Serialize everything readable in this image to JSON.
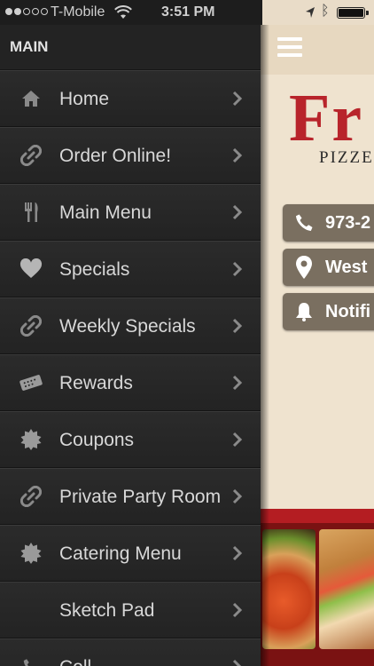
{
  "status_bar": {
    "carrier": "T-Mobile",
    "time": "3:51 PM",
    "signal_bars_filled": 2,
    "signal_bars_total": 5
  },
  "sidebar": {
    "header": "MAIN",
    "items": [
      {
        "label": "Home",
        "icon": "home-icon"
      },
      {
        "label": "Order Online!",
        "icon": "link-icon"
      },
      {
        "label": "Main Menu",
        "icon": "fork-knife-icon"
      },
      {
        "label": "Specials",
        "icon": "heart-icon"
      },
      {
        "label": "Weekly Specials",
        "icon": "link-icon"
      },
      {
        "label": "Rewards",
        "icon": "ticket-icon"
      },
      {
        "label": "Coupons",
        "icon": "badge-icon"
      },
      {
        "label": "Private Party Room",
        "icon": "link-icon"
      },
      {
        "label": "Catering Menu",
        "icon": "badge-icon"
      },
      {
        "label": "Sketch Pad",
        "icon": ""
      },
      {
        "label": "Coll",
        "icon": "phone-icon"
      }
    ]
  },
  "main": {
    "brand_title": "Fr",
    "brand_subtitle": "PIZZE",
    "buttons": [
      {
        "label": "973-2",
        "icon": "phone-icon"
      },
      {
        "label": "West",
        "icon": "map-pin-icon"
      },
      {
        "label": "Notifi",
        "icon": "bell-icon"
      }
    ]
  },
  "colors": {
    "sidebar_bg": "#262626",
    "main_bg": "#efe3cf",
    "brand_red": "#b8242b",
    "info_button_bg": "#7a6f60"
  }
}
